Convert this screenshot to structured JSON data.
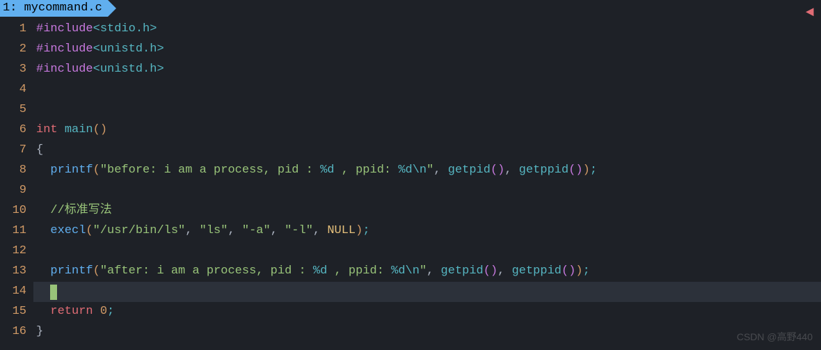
{
  "tab": {
    "index": "1:",
    "filename": "mycommand.c"
  },
  "code": {
    "line1": {
      "directive": "#include",
      "path": "<stdio.h>"
    },
    "line2": {
      "directive": "#include",
      "path": "<unistd.h>"
    },
    "line3": {
      "directive": "#include",
      "path": "<unistd.h>"
    },
    "line6": {
      "type": "int",
      "name": "main",
      "parens": "()"
    },
    "line7": {
      "brace": "{"
    },
    "line8": {
      "func": "printf",
      "string_pre": "\"before: i am a process, pid : ",
      "fmt1": "%d",
      "mid1": " , ppid: ",
      "fmt2": "%d",
      "esc": "\\n",
      "string_post": "\"",
      "comma1": ", ",
      "call1": "getpid",
      "p1": "()",
      "comma2": ", ",
      "call2": "getppid",
      "p2": "()",
      "close": ")",
      "semi": ";"
    },
    "line10": {
      "comment": "//标准写法"
    },
    "line11": {
      "func": "execl",
      "open": "(",
      "arg1": "\"/usr/bin/ls\"",
      "c1": ", ",
      "arg2": "\"ls\"",
      "c2": ", ",
      "arg3": "\"-a\"",
      "c3": ", ",
      "arg4": "\"-l\"",
      "c4": ", ",
      "null": "NULL",
      "close": ")",
      "semi": ";"
    },
    "line13": {
      "func": "printf",
      "string_pre": "\"after: i am a process, pid : ",
      "fmt1": "%d",
      "mid1": " , ppid: ",
      "fmt2": "%d",
      "esc": "\\n",
      "string_post": "\"",
      "comma1": ", ",
      "call1": "getpid",
      "p1": "()",
      "comma2": ", ",
      "call2": "getppid",
      "p2": "()",
      "close": ")",
      "semi": ";"
    },
    "line15": {
      "keyword": "return",
      "value": "0",
      "semi": ";"
    },
    "line16": {
      "brace": "}"
    }
  },
  "lineNumbers": [
    "1",
    "2",
    "3",
    "4",
    "5",
    "6",
    "7",
    "8",
    "9",
    "10",
    "11",
    "12",
    "13",
    "14",
    "15",
    "16"
  ],
  "watermark": "CSDN @高野440"
}
